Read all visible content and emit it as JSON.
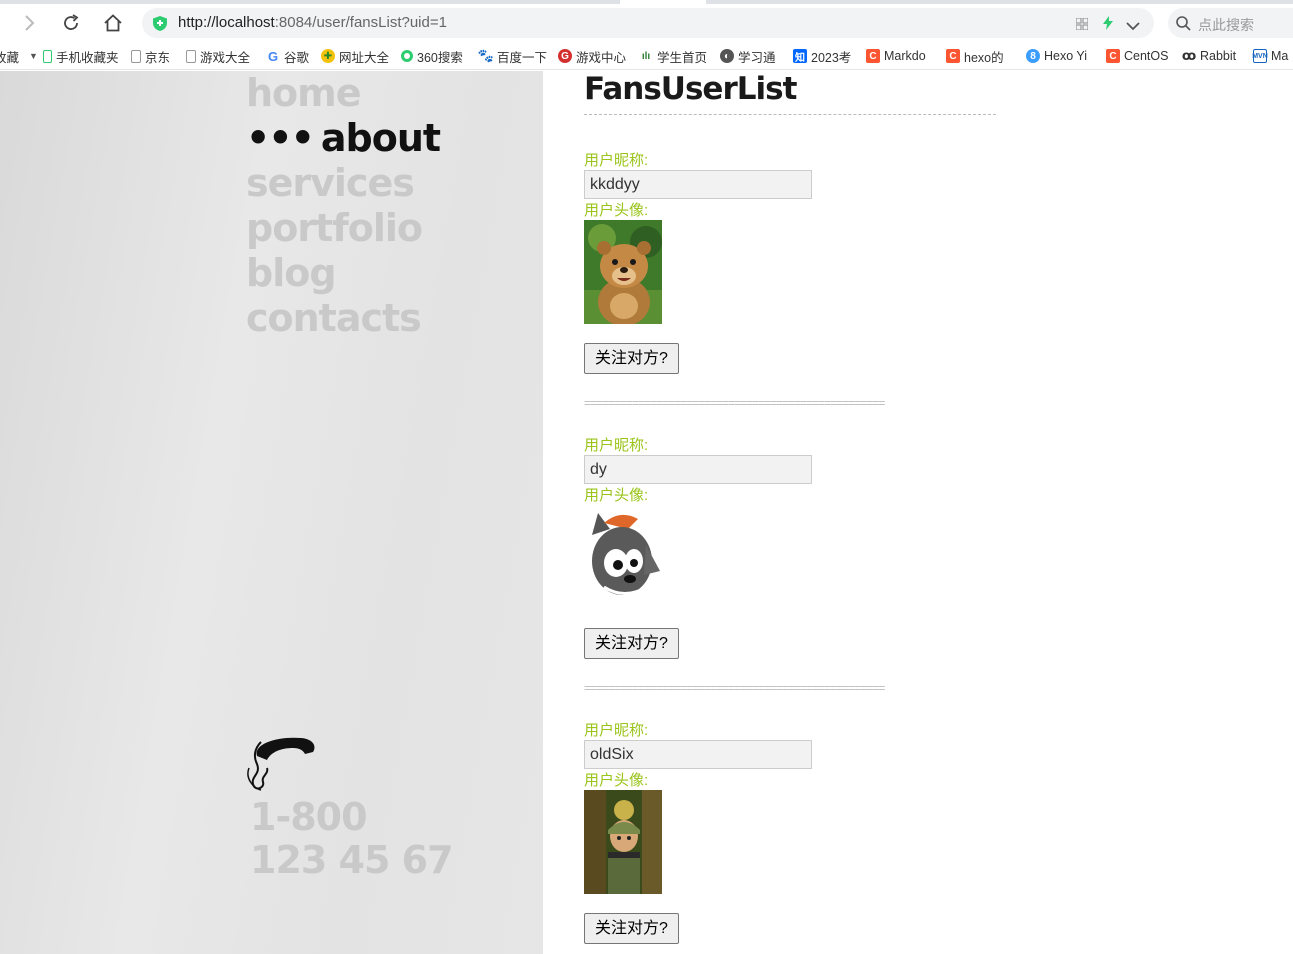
{
  "browser": {
    "url_host": "http://localhost",
    "url_rest": ":8084/user/fansList?uid=1",
    "search_placeholder": "点此搜索",
    "bookmarks": [
      {
        "label": "收藏",
        "icon": "star-icon"
      },
      {
        "label": "手机收藏夹",
        "icon": "phone-bookmark-icon"
      },
      {
        "label": "京东",
        "icon": "page-icon"
      },
      {
        "label": "游戏大全",
        "icon": "page-icon"
      },
      {
        "label": "谷歌",
        "icon": "google-icon"
      },
      {
        "label": "网址大全",
        "icon": "site-nav-icon"
      },
      {
        "label": "360搜索",
        "icon": "360-search-icon"
      },
      {
        "label": "百度一下",
        "icon": "baidu-icon"
      },
      {
        "label": "游戏中心",
        "icon": "game-center-icon"
      },
      {
        "label": "学生首页",
        "icon": "student-icon"
      },
      {
        "label": "学习通",
        "icon": "globe-icon"
      },
      {
        "label": "2023考",
        "icon": "zhihu-icon"
      },
      {
        "label": "Markdo",
        "icon": "csdn-icon"
      },
      {
        "label": "hexo的",
        "icon": "csdn-icon"
      },
      {
        "label": "Hexo Yi",
        "icon": "hexo-icon"
      },
      {
        "label": "CentOS",
        "icon": "csdn-icon"
      },
      {
        "label": "Rabbit",
        "icon": "rabbit-icon"
      },
      {
        "label": "Ma",
        "icon": "mvn-icon"
      }
    ]
  },
  "menu": {
    "items": [
      {
        "label": "home",
        "active": false
      },
      {
        "label": "about",
        "active": true,
        "prefix": "•••"
      },
      {
        "label": "services",
        "active": false
      },
      {
        "label": "portfolio",
        "active": false
      },
      {
        "label": "blog",
        "active": false
      },
      {
        "label": "contacts",
        "active": false
      }
    ],
    "phone_line1": "1-800",
    "phone_line2": "123 45 67"
  },
  "content": {
    "title": "FansUserList",
    "nickname_label": "用户昵称:",
    "avatar_label": "用户头像:",
    "follow_label": "关注对方?",
    "separator": "==================================================",
    "fans": [
      {
        "nickname": "kkddyy",
        "avatar": "bear-avatar-icon"
      },
      {
        "nickname": "dy",
        "avatar": "wolf-avatar-icon"
      },
      {
        "nickname": "oldSix",
        "avatar": "logger-avatar-icon"
      }
    ]
  }
}
